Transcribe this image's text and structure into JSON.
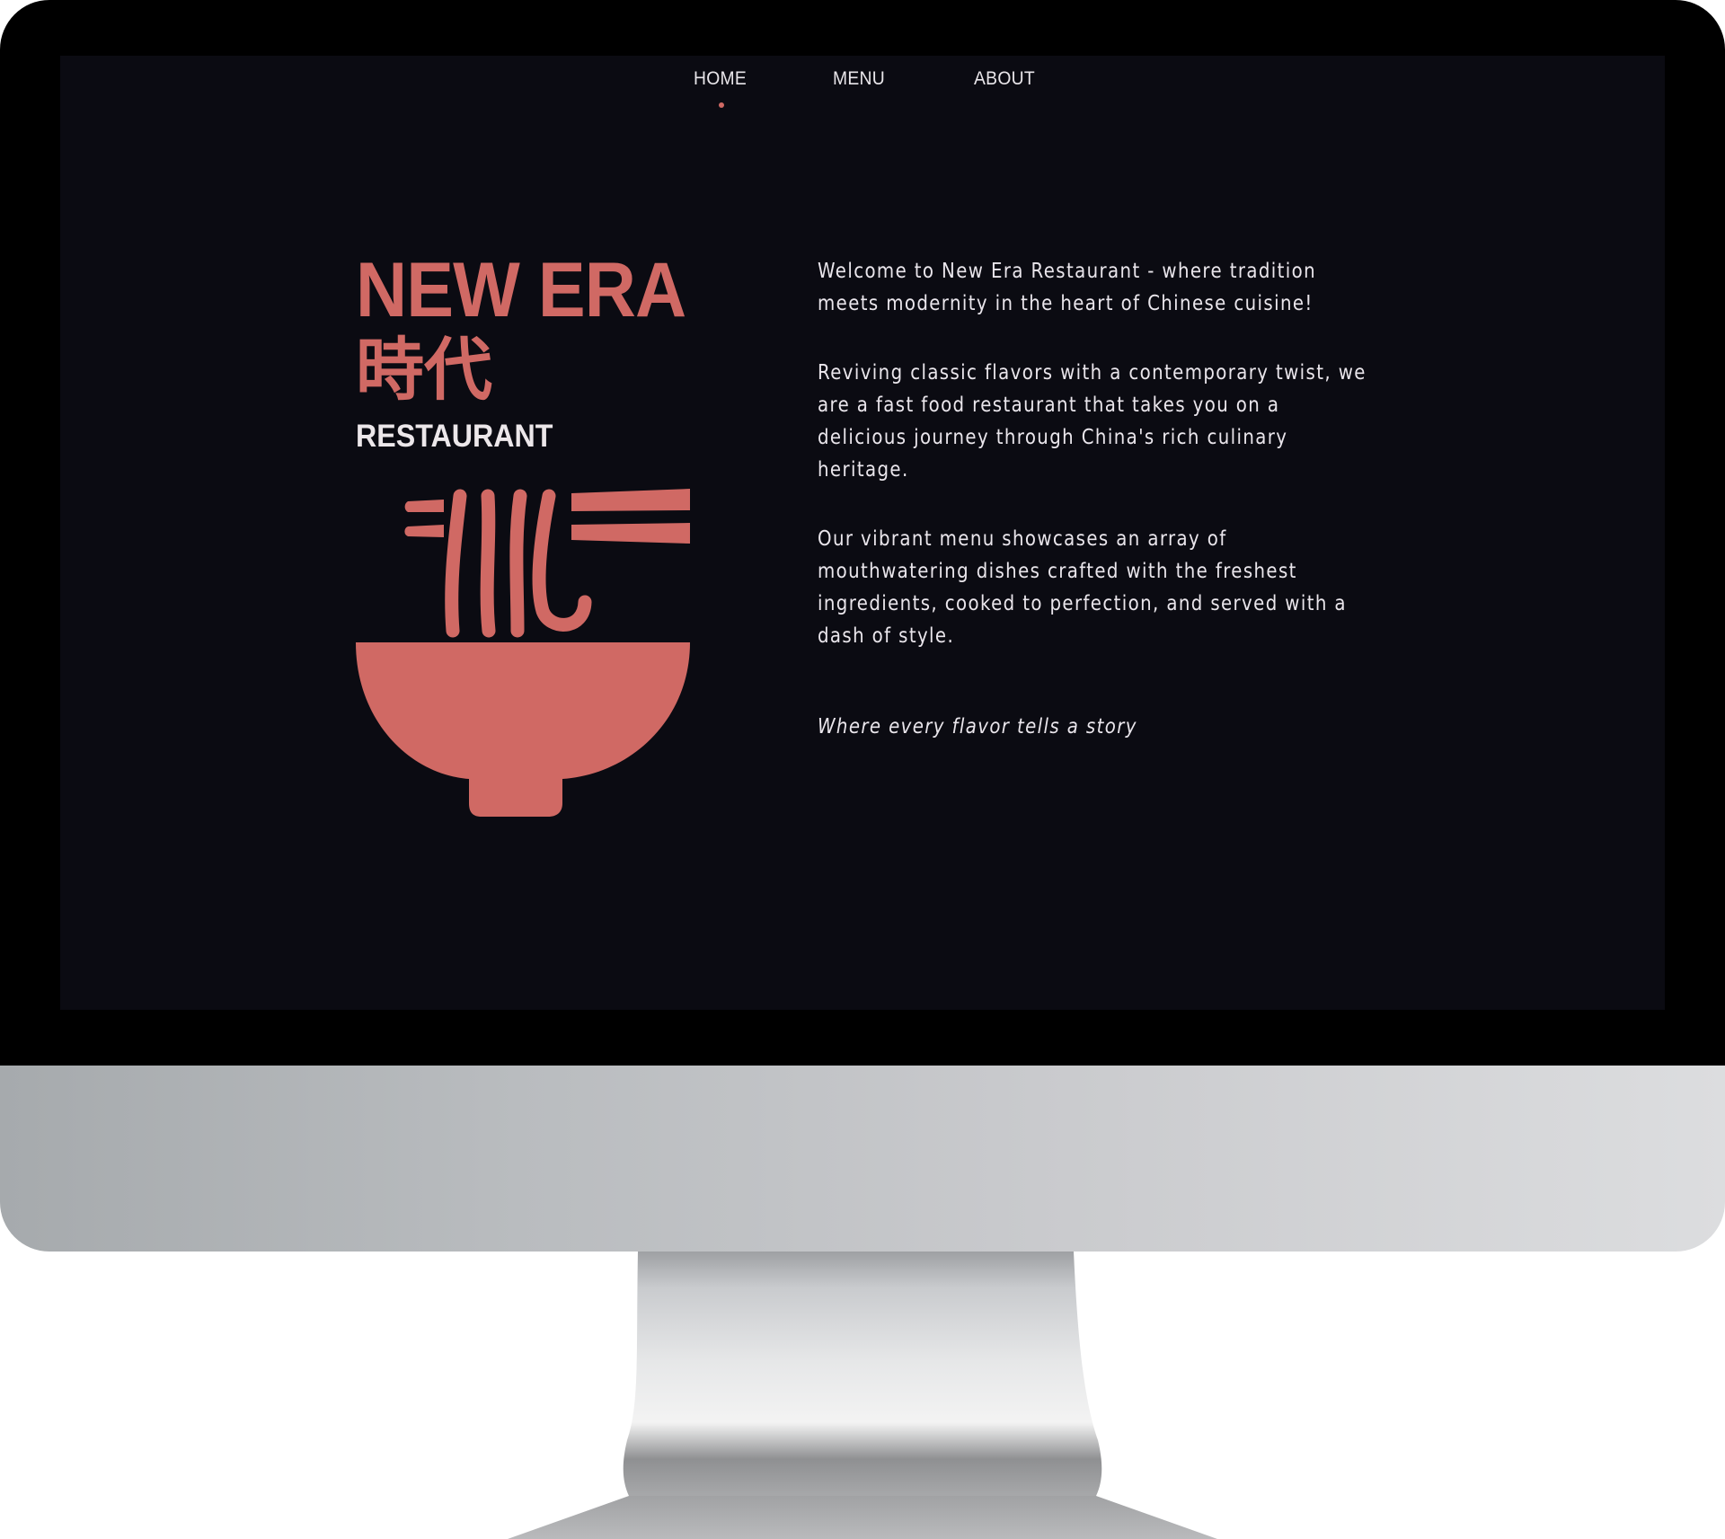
{
  "nav": {
    "items": [
      {
        "label": "HOME",
        "active": true
      },
      {
        "label": "MENU",
        "active": false
      },
      {
        "label": "ABOUT",
        "active": false
      }
    ]
  },
  "brand": {
    "title": "NEW ERA",
    "title_cjk": "時代",
    "subtitle": "RESTAURANT",
    "logo_icon": "noodle-bowl-with-chopsticks-icon"
  },
  "content": {
    "paragraphs": [
      "Welcome to New Era Restaurant - where tradition meets modernity in the heart of Chinese cuisine!",
      "Reviving classic flavors with a contemporary twist, we are a fast food restaurant that takes you on a delicious journey through China's rich culinary heritage.",
      "Our vibrant menu showcases an array of mouthwatering dishes crafted with the freshest ingredients, cooked to perfection, and served with a dash of style."
    ],
    "tagline": "Where every flavor tells a story"
  },
  "colors": {
    "accent": "#d06964",
    "background": "#0b0b12",
    "text": "#eae6ec",
    "bezel": "#000000",
    "chin": "#bfc1c4"
  }
}
